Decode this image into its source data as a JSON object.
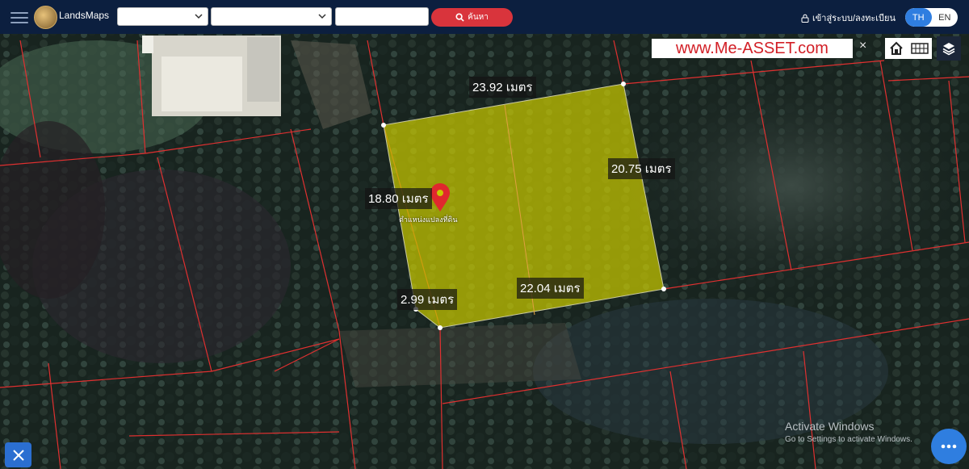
{
  "app": {
    "brand": "LandsMaps"
  },
  "header": {
    "province_select": "",
    "district_select": "",
    "parcel_input": "",
    "search_label": "ค้นหา",
    "login_label": "เข้าสู่ระบบ/ลงทะเบียน",
    "lang_th": "TH",
    "lang_en": "EN",
    "active_lang": "TH"
  },
  "map": {
    "watermark": "www.Me-ASSET.com",
    "close_label": "×",
    "parcel_pin_label": "ตำแหน่งแปลงที่ดิน",
    "dimensions": {
      "top": "23.92 เมตร",
      "right": "20.75 เมตร",
      "left": "18.80 เมตร",
      "bottom": "22.04 เมตร",
      "corner": "2.99 เมตร"
    },
    "highlight_color": "#c8c800",
    "boundary_color": "#e03030"
  },
  "os_notice": {
    "title": "Activate Windows",
    "subtitle": "Go to Settings to activate Windows."
  }
}
